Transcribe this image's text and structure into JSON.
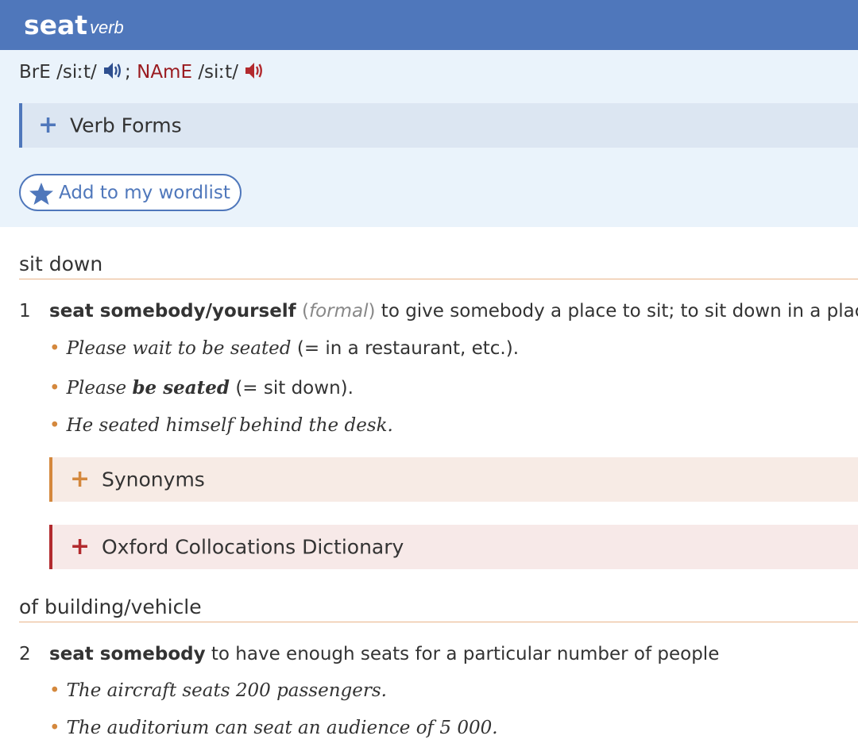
{
  "entry": {
    "headword": "seat",
    "pos": "verb"
  },
  "pronunciation": {
    "bre_label": "BrE",
    "bre_ipa": "/siːt/",
    "separator": ";",
    "name_label": "NAmE",
    "name_ipa": "/siːt/",
    "bre_speaker_color": "#2e4f8f",
    "name_speaker_color": "#b22a2e"
  },
  "verb_forms": {
    "label": "Verb Forms",
    "plus": "+"
  },
  "wordlist_button": {
    "label": "Add to my wordlist"
  },
  "shortcuts": [
    {
      "label": "sit down"
    },
    {
      "label": "of building/vehicle"
    }
  ],
  "senses": [
    {
      "number": "1",
      "cf": "seat somebody/yourself",
      "label_open": "(",
      "label": "formal",
      "label_close": ")",
      "definition": " to give somebody a place to sit; to sit down in a place",
      "examples": [
        {
          "text": "Please wait to be seated",
          "gloss": " (= in a restaurant, etc.)."
        },
        {
          "text_before": "Please ",
          "text_bold": "be seated",
          "gloss": " (= sit down)."
        },
        {
          "text": "He seated himself behind the desk."
        }
      ],
      "boxes": [
        {
          "label": "Synonyms",
          "plus": "+"
        },
        {
          "label": "Oxford Collocations Dictionary",
          "plus": "+"
        }
      ]
    },
    {
      "number": "2",
      "cf": "seat somebody",
      "definition": " to have enough seats for a particular number of people",
      "examples": [
        {
          "text": "The aircraft seats 200 passengers."
        },
        {
          "text": "The auditorium can seat an audience of 5 000."
        }
      ]
    }
  ],
  "colors": {
    "header_bg": "#4f77bb",
    "top_box_bg": "#eaf3fb",
    "accent_blue": "#4f77bb",
    "accent_orange": "#d4883d",
    "accent_red": "#b22a2e"
  }
}
